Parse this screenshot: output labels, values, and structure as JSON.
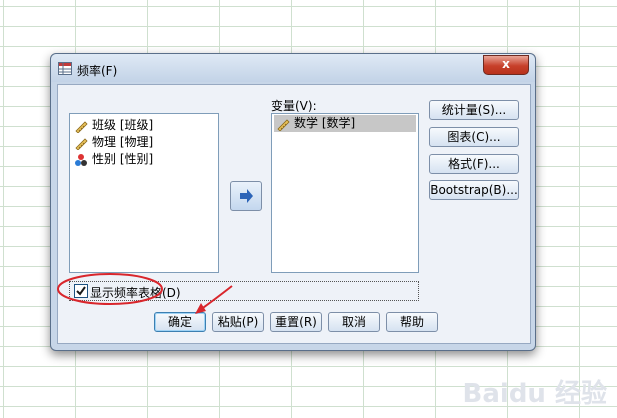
{
  "dialog": {
    "title": "频率(F)",
    "close_symbol": "x"
  },
  "source_list": {
    "items": [
      {
        "label": "班级 [班级]",
        "icon": "ruler-scale-icon"
      },
      {
        "label": "物理 [物理]",
        "icon": "ruler-scale-icon"
      },
      {
        "label": "性别 [性别]",
        "icon": "nominal-balls-icon"
      }
    ]
  },
  "variables": {
    "label": "变量(V):",
    "items": [
      {
        "label": "数学 [数学]",
        "icon": "ruler-scale-icon",
        "selected": true
      }
    ]
  },
  "move_button": {
    "icon": "arrow-right-icon"
  },
  "side_buttons": {
    "statistics": "统计量(S)...",
    "charts": "图表(C)...",
    "format": "格式(F)...",
    "bootstrap": "Bootstrap(B)..."
  },
  "checkbox": {
    "label": "显示频率表格(D)",
    "checked": true
  },
  "bottom_buttons": {
    "ok": "确定",
    "paste": "粘贴(P)",
    "reset": "重置(R)",
    "cancel": "取消",
    "help": "帮助"
  },
  "watermark": "Baidu 经验",
  "colors": {
    "annotation_red": "#d9262c",
    "close_red": "#c7402a"
  }
}
